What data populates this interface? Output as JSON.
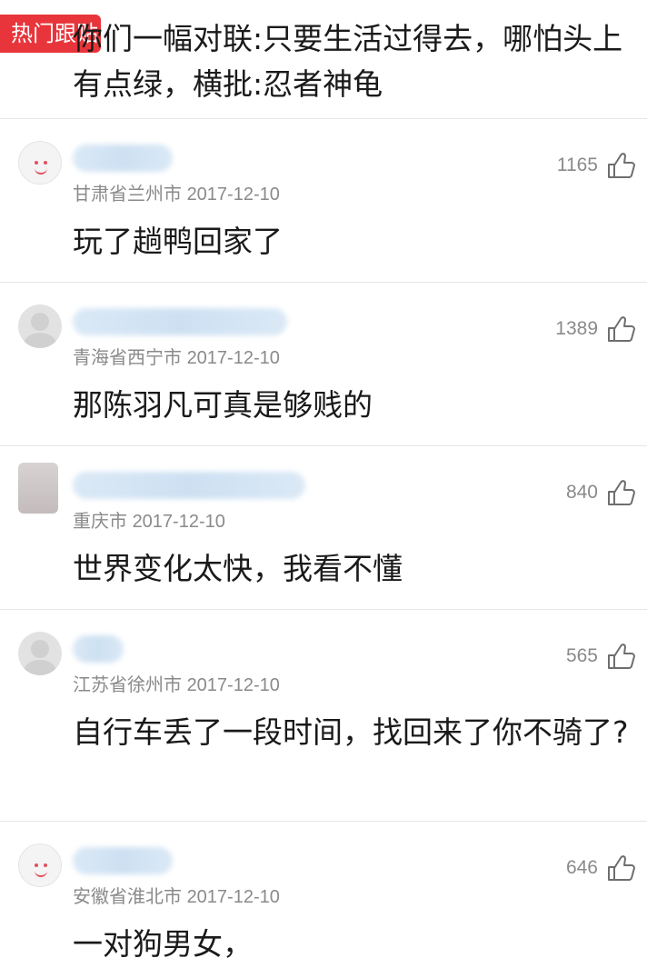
{
  "top_comment": {
    "badge": "热门跟贴",
    "text": "你们一幅对联:只要生活过得去，哪怕头上有点绿，横批:忍者神龟"
  },
  "comments": [
    {
      "location": "甘肃省兰州市",
      "date": "2017-12-10",
      "likes": "1165",
      "text": "玩了趟鸭回家了",
      "avatar": "smiley-avatar"
    },
    {
      "location": "青海省西宁市",
      "date": "2017-12-10",
      "likes": "1389",
      "text": "那陈羽凡可真是够贱的",
      "avatar": "default-avatar"
    },
    {
      "location": "重庆市",
      "date": "2017-12-10",
      "likes": "840",
      "text": "世界变化太快，我看不懂",
      "avatar": "photo-avatar"
    },
    {
      "location": "江苏省徐州市",
      "date": "2017-12-10",
      "likes": "565",
      "text": "自行车丢了一段时间，找回来了你不骑了?",
      "avatar": "default-avatar"
    },
    {
      "location": "安徽省淮北市",
      "date": "2017-12-10",
      "likes": "646",
      "text": "一对狗男女，",
      "avatar": "smiley-avatar"
    }
  ],
  "colors": {
    "badge": "#e8353b",
    "meta": "#8a8a8a",
    "divider": "#e6e6e6"
  },
  "icons": {
    "like": "thumbs-up-icon"
  }
}
